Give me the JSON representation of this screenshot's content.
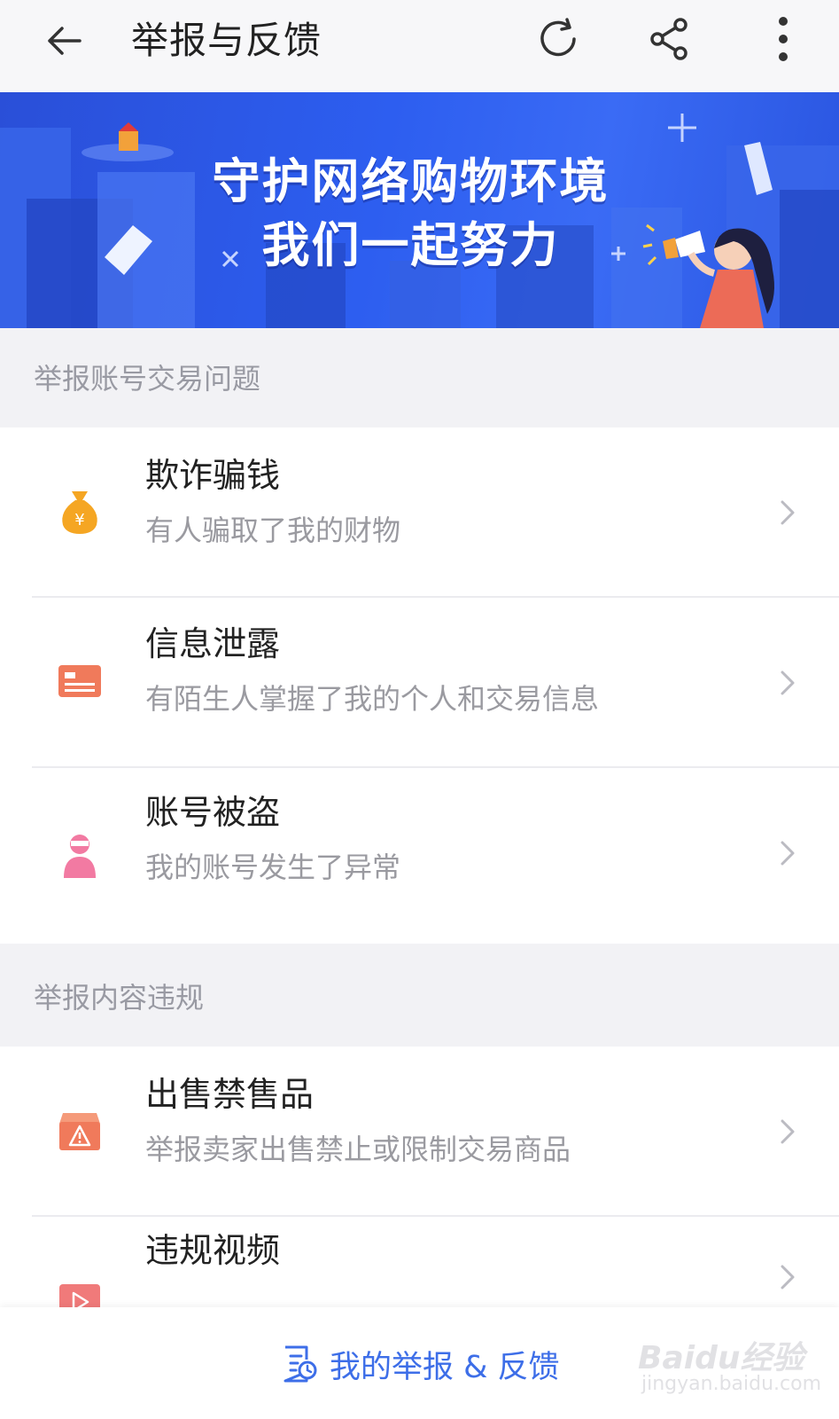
{
  "header": {
    "title": "举报与反馈",
    "back_icon": "arrow-left-icon",
    "refresh_icon": "refresh-icon",
    "share_icon": "share-icon",
    "more_icon": "more-vertical-icon"
  },
  "banner": {
    "line1": "守护网络购物环境",
    "line2": "我们一起努力"
  },
  "sections": [
    {
      "title": "举报账号交易问题",
      "items": [
        {
          "title": "欺诈骗钱",
          "subtitle": "有人骗取了我的财物",
          "icon": "money-bag-icon",
          "color": "#f5a623"
        },
        {
          "title": "信息泄露",
          "subtitle": "有陌生人掌握了我的个人和交易信息",
          "icon": "card-icon",
          "color": "#f07a5b"
        },
        {
          "title": "账号被盗",
          "subtitle": "我的账号发生了异常",
          "icon": "thief-icon",
          "color": "#f27aa2"
        }
      ]
    },
    {
      "title": "举报内容违规",
      "items": [
        {
          "title": "出售禁售品",
          "subtitle": "举报卖家出售禁止或限制交易商品",
          "icon": "warning-box-icon",
          "color": "#f07a5b"
        },
        {
          "title": "违规视频",
          "subtitle": "",
          "icon": "video-play-icon",
          "color": "#f07a7a"
        }
      ]
    }
  ],
  "bottom": {
    "label": "我的举报 & 反馈",
    "icon": "report-list-icon"
  },
  "watermark": {
    "brand": "Baidu经验",
    "url": "jingyan.baidu.com"
  },
  "colors": {
    "accent": "#3d6ee8",
    "banner": "#2d5ef0",
    "section_bg": "#f2f2f5"
  }
}
